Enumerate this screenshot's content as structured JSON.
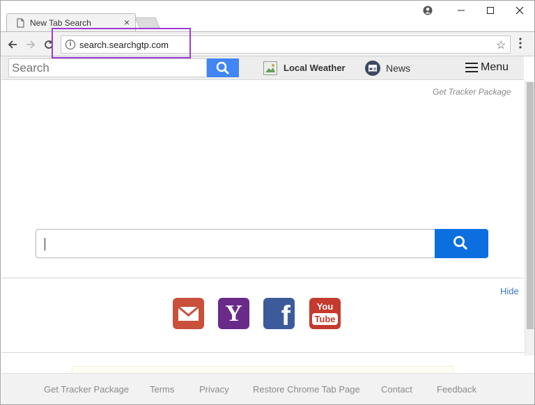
{
  "browser": {
    "tab_title": "New Tab Search",
    "tab_close": "×",
    "url": "search.searchgtp.com",
    "window_controls": {
      "profile": "●",
      "minimize": "—",
      "maximize": "☐",
      "close": "✕"
    },
    "nav": {
      "back": "←",
      "forward": "→",
      "reload": "⟳"
    },
    "star": "☆",
    "menu_dots": "⋮"
  },
  "header": {
    "search_placeholder": "Search",
    "weather_label": "Local Weather",
    "news_label": "News",
    "menu_label": "Menu"
  },
  "tracker_link": "Get Tracker Package",
  "shortcuts": {
    "hide_label": "Hide",
    "tiles": [
      {
        "name": "gmail",
        "glyph": "✉"
      },
      {
        "name": "yahoo",
        "glyph": "Y"
      },
      {
        "name": "facebook",
        "glyph": "f"
      },
      {
        "name": "youtube",
        "glyph_top": "You",
        "glyph_bottom": "Tube"
      }
    ]
  },
  "footer": {
    "links": [
      "Get Tracker Package",
      "Terms",
      "Privacy",
      "Restore Chrome Tab Page",
      "Contact",
      "Feedback"
    ]
  },
  "colors": {
    "accent_blue": "#4285f4",
    "main_search_blue": "#0b6fe0",
    "highlight_purple": "#9b3bd4"
  }
}
